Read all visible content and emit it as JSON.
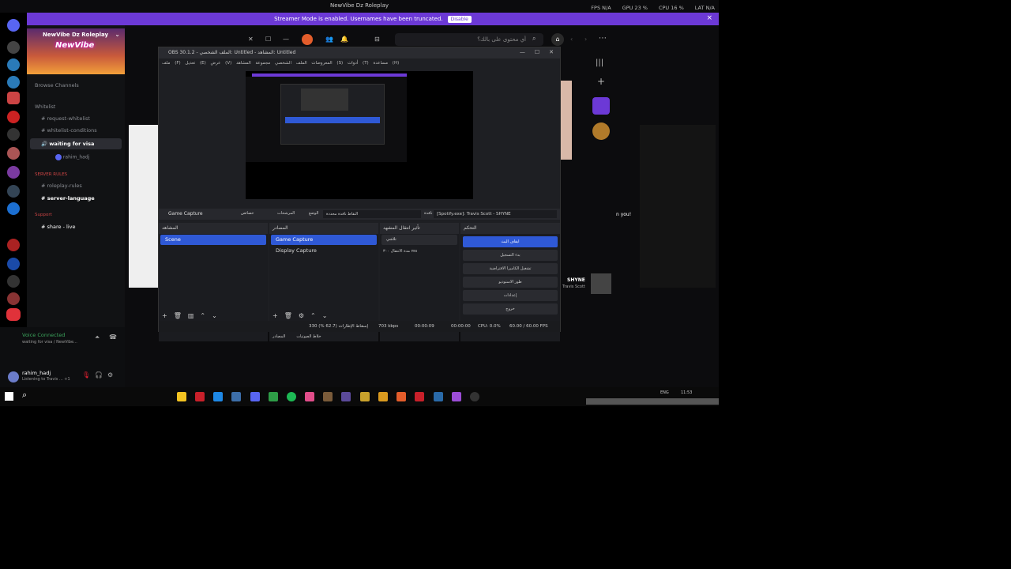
{
  "window": {
    "title": "NewVibe Dz Roleplay"
  },
  "stats": {
    "fps": "FPS  N/A",
    "gpu": "GPU  23 %",
    "cpu": "CPU  16 %",
    "lat": "LAT  N/A"
  },
  "streamer": {
    "text": "Streamer Mode is enabled. Usernames have been truncated.",
    "button": "Disable"
  },
  "server": {
    "name": "NewVibe Dz Roleplay",
    "banner_logo": "NewVibe",
    "browse": "Browse Channels",
    "channels": [
      {
        "label": "Whitelist",
        "type": "category"
      },
      {
        "label": "request-whitelist",
        "type": "text"
      },
      {
        "label": "whitelist-conditions",
        "type": "text"
      },
      {
        "label": "waiting for visa",
        "type": "voice"
      },
      {
        "label": "rahim_hadj",
        "type": "member"
      },
      {
        "label": "SERVER RULES",
        "type": "category"
      },
      {
        "label": "roleplay-rules",
        "type": "text"
      },
      {
        "label": "server-language",
        "type": "text"
      },
      {
        "label": "Support",
        "type": "category"
      },
      {
        "label": "share - live",
        "type": "text"
      }
    ]
  },
  "voice": {
    "status": "Voice Connected",
    "sub": "waiting for visa / NewVibe..."
  },
  "user": {
    "name": "rahim_hadj",
    "activity": "Listening to Travis ... +1"
  },
  "search": {
    "placeholder": "أي محتوى على بالك؟"
  },
  "obs": {
    "title": "OBS 30.1.2 - الملف الشخصي: Untitled - المشاهد: Untitled",
    "menu": "ملف (F)   تعديل (E)   عرض (V)   المعروضات   الملف الشخصي   مجموعة المشاهد (S)   أدوات (T)   مساعدة (H)",
    "context_source": "Game Capture",
    "context_props": "خصائص",
    "context_filters": "المرشحات",
    "context_mode_label": "الوضع",
    "context_mode": "التقاط نافذة محددة",
    "context_window_label": "نافذة",
    "context_window": "[Spotify.exe]: Travis Scott - SHYNE",
    "docks": {
      "scenes": {
        "title": "المشاهد",
        "items": [
          "Scene"
        ]
      },
      "sources": {
        "title": "المصادر",
        "items": [
          "Game Capture",
          "Display Capture"
        ],
        "tabs": [
          "المصادر",
          "خلاط الصوتيات"
        ]
      },
      "transitions": {
        "title": "تأثير انتقال المشهد",
        "type": "تلاشي",
        "duration_label": "مدة الانتقال",
        "duration": "٣٠٠ ms"
      },
      "controls": {
        "title": "التحكم",
        "buttons": [
          "ايقاف البث",
          "بدء التسجيل",
          "تشغيل الكاميرا الافتراضية",
          "طور الاستوديو",
          "إعدادات",
          "خروج"
        ]
      }
    },
    "status": {
      "dropped": "إسقاط الإطارات (62.7 %) 330",
      "bitrate": "703 kbps",
      "stream_time": "00:00:09",
      "rec_time": "00:00:00",
      "cpu": "CPU: 0.0%",
      "fps": "60.00 / 60.00 FPS"
    }
  },
  "spotify_side": {
    "track": "SHYNE",
    "artist": "Travis Scott",
    "text": "n you!"
  },
  "tray": {
    "time": "11:53",
    "lang": "ENG"
  }
}
